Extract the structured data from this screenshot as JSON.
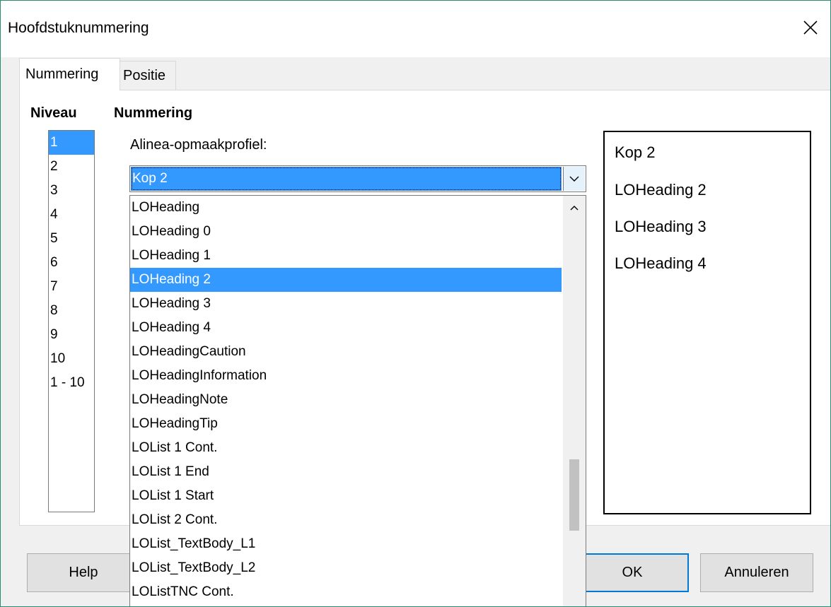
{
  "window": {
    "title": "Hoofdstuknummering"
  },
  "tabs": [
    {
      "label": "Nummering"
    },
    {
      "label": "Positie"
    }
  ],
  "level_section": {
    "heading": "Niveau",
    "items": [
      "1",
      "2",
      "3",
      "4",
      "5",
      "6",
      "7",
      "8",
      "9",
      "10",
      "1 - 10"
    ],
    "selected": "1"
  },
  "numbering_section": {
    "heading": "Nummering",
    "para_style_label": "Alinea-opmaakprofiel:",
    "para_style_value": "Kop 2"
  },
  "dropdown": {
    "items": [
      "LOHeading",
      "LOHeading 0",
      "LOHeading 1",
      "LOHeading 2",
      "LOHeading 3",
      "LOHeading 4",
      "LOHeadingCaution",
      "LOHeadingInformation",
      "LOHeadingNote",
      "LOHeadingTip",
      "LOList 1 Cont.",
      "LOList 1 End",
      "LOList 1 Start",
      "LOList 2 Cont.",
      "LOList_TextBody_L1",
      "LOList_TextBody_L2",
      "LOListTNC Cont."
    ],
    "highlighted": "LOHeading 2"
  },
  "preview": {
    "lines": [
      "Kop 2",
      "LOHeading 2",
      "LOHeading 3",
      "LOHeading 4"
    ]
  },
  "buttons": {
    "help": "Help",
    "ok": "OK",
    "cancel": "Annuleren"
  },
  "colors": {
    "selection": "#3399ff",
    "primary_border": "#0078d7"
  }
}
